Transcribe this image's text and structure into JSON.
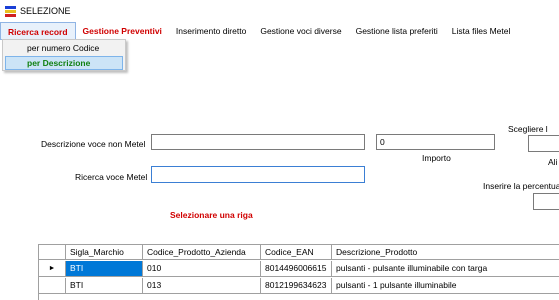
{
  "window": {
    "title": "SELEZIONE"
  },
  "menu": {
    "items": [
      {
        "label": "Ricerca record",
        "red": true,
        "active": true
      },
      {
        "label": "Gestione Preventivi",
        "red": true
      },
      {
        "label": "Inserimento diretto"
      },
      {
        "label": "Gestione voci diverse"
      },
      {
        "label": "Gestione lista preferiti"
      },
      {
        "label": "Lista files Metel"
      }
    ],
    "dropdown": [
      {
        "label": "per numero Codice"
      },
      {
        "label": "per Descrizione",
        "highlighted": true
      }
    ]
  },
  "form": {
    "descrizione_label": "Descrizione voce non Metel",
    "descrizione_value": "",
    "importo_value": "0",
    "importo_label": "Importo",
    "ricerca_label": "Ricerca voce Metel",
    "ricerca_value": "",
    "scegliere_label": "Scegliere l",
    "ali_label": "Ali",
    "percentuale_label": "Inserire la percentua",
    "selezionare_label": "Selezionare una riga"
  },
  "grid": {
    "columns": [
      "",
      "Sigla_Marchio",
      "Codice_Prodotto_Azienda",
      "Codice_EAN",
      "Descrizione_Prodotto"
    ],
    "rows": [
      {
        "indicator": "►",
        "sigla": "BTI",
        "codice": "010",
        "ean": "8014496006615",
        "descrizione": "pulsanti - pulsante illuminabile con targa",
        "selected": true
      },
      {
        "indicator": "",
        "sigla": "BTI",
        "codice": "013",
        "ean": "8012199634623",
        "descrizione": "pulsanti - 1 pulsante illuminabile",
        "selected": false
      }
    ]
  },
  "colors": {
    "accent_red": "#d00000",
    "selection": "#0078d7",
    "dropdown_highlight": "#cce4f7",
    "dropdown_text_green": "#108010"
  }
}
